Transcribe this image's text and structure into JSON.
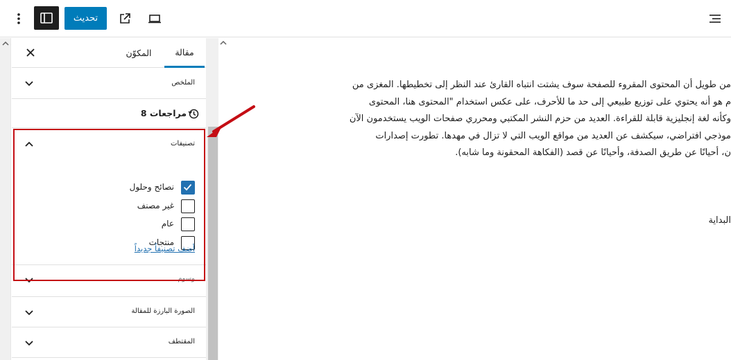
{
  "toolbar": {
    "update_label": "تحديث",
    "icons": {
      "more": "vertical-ellipsis-icon",
      "sidebar": "sidebar-panel-icon",
      "external": "external-link-icon",
      "device": "desktop-preview-icon",
      "overview": "document-overview-icon"
    }
  },
  "sidebar": {
    "tabs": [
      {
        "label": "مقالة",
        "active": true
      },
      {
        "label": "المكوّن",
        "active": false
      }
    ],
    "panels": {
      "summary": "الملخص",
      "revisions": "8 مراجعات",
      "categories": "تصنيفات",
      "tags_partial": "وسوم",
      "featured_image": "الصورة البارزة للمقالة",
      "excerpt": "المقتطف"
    },
    "categories": [
      {
        "label": "نصائح وحلول",
        "checked": true
      },
      {
        "label": "غير مصنف",
        "checked": false
      },
      {
        "label": "عام",
        "checked": false
      },
      {
        "label": "منتجات",
        "checked": false
      }
    ],
    "add_category_label": "أضف تصنيفاً جديداً"
  },
  "editor": {
    "lines": [
      "من طويل أن المحتوى المقروء للصفحة سوف يشتت انتباه القارئ عند النظر إلى تخطيطها. المغزى من",
      "م هو أنه يحتوي على توزيع طبيعي إلى حد ما للأحرف، على عكس استخدام \"المحتوى هنا، المحتوى",
      "وكأنه لغة إنجليزية قابلة للقراءة. العديد من حزم النشر المكتبي ومحرري صفحات الويب يستخدمون الآن",
      "موذجي افتراضي، سيكشف عن العديد من مواقع الويب التي لا تزال في مهدها. تطورت إصدارات",
      "ن، أحيانًا عن طريق الصدفة، وأحيانًا عن قصد (الفكاهة المحقونة وما شابه)."
    ],
    "start_word": "البداية"
  },
  "colors": {
    "accent": "#007cba",
    "annotation": "#c40d14",
    "checkbox": "#2271b1"
  }
}
